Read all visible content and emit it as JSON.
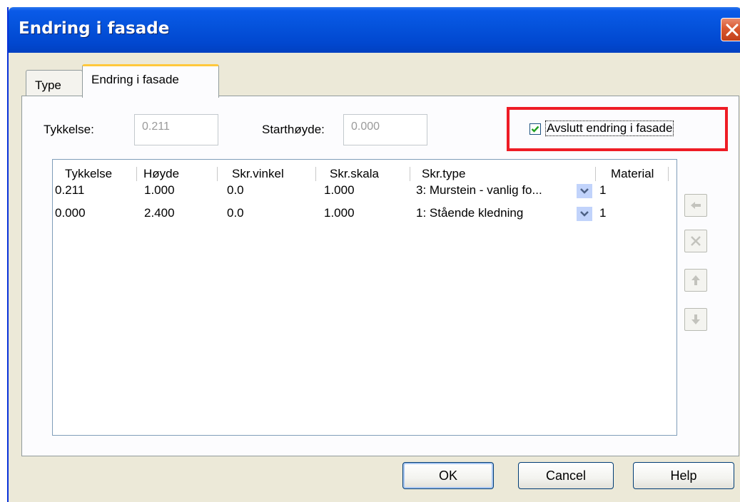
{
  "window": {
    "title": "Endring i fasade"
  },
  "tabs": [
    {
      "label": "Type"
    },
    {
      "label": "Endring i fasade"
    }
  ],
  "form": {
    "tykkelse_label": "Tykkelse:",
    "tykkelse_value": "0.211",
    "starthoyde_label": "Starthøyde:",
    "starthoyde_value": "0.000",
    "avslutt_label": "Avslutt endring i fasade",
    "avslutt_checked": true
  },
  "table": {
    "columns": [
      "Tykkelse",
      "Høyde",
      "Skr.vinkel",
      "Skr.skala",
      "Skr.type",
      "Material"
    ],
    "rows": [
      {
        "tykkelse": "0.211",
        "hoyde": "1.000",
        "vinkel": "0.0",
        "skala": "1.000",
        "type": "3: Murstein - vanlig fo...",
        "material": "1"
      },
      {
        "tykkelse": "0.000",
        "hoyde": "2.400",
        "vinkel": "0.0",
        "skala": "1.000",
        "type": "1: Stående kledning",
        "material": "1"
      }
    ]
  },
  "side_buttons": [
    "arrow-left-icon",
    "delete-x-icon",
    "arrow-up-icon",
    "arrow-down-icon"
  ],
  "buttons": {
    "ok": "OK",
    "cancel": "Cancel",
    "help": "Help"
  },
  "colors": {
    "titlebar": "#0553dc",
    "dialog_bg": "#ece9d8",
    "highlight": "#ee1c25",
    "tab_accent": "#ffc83c"
  }
}
